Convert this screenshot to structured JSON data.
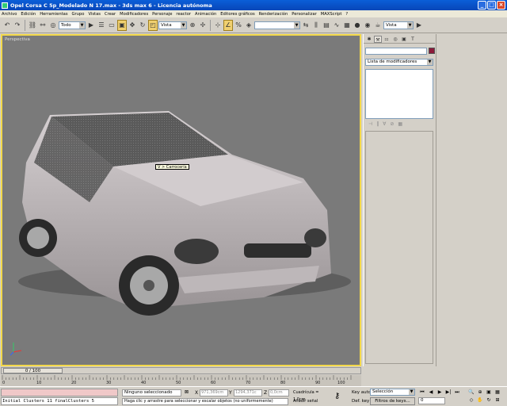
{
  "window": {
    "title": "Opel Corsa C 5p_Modelado N 17.max - 3ds max 6 - Licencia autónoma",
    "controls": [
      "_",
      "□",
      "×"
    ]
  },
  "menu": [
    "Archivo",
    "Edición",
    "Herramientas",
    "Grupo",
    "Vistas",
    "Crear",
    "Modificadores",
    "Personaje",
    "reactor",
    "Animación",
    "Editores gráficos",
    "Renderización",
    "Personalizar",
    "MAXScript",
    "?"
  ],
  "toolbar": {
    "selection_filter": "Todo",
    "ref_coord": "Vista",
    "named_sel": "",
    "render_view": "Vista"
  },
  "viewport": {
    "label": "Perspectiva",
    "tooltip": "V > Carrocería"
  },
  "command_panel": {
    "name_value": "",
    "object_color": "#8b1a3a",
    "modifier_list": "Lista de modificadores"
  },
  "time_slider": {
    "position": "0 / 100"
  },
  "trackbar": {
    "ticks": [
      "0",
      "10",
      "20",
      "30",
      "40",
      "50",
      "60",
      "70",
      "80",
      "90",
      "100"
    ]
  },
  "status": {
    "listener_output": "Initial Clusters 11 finalClusters 5",
    "selection": "Ninguno seleccionado",
    "x_label": "X",
    "x_value": "971,369cm",
    "y_label": "Y",
    "y_value": "1294,371c",
    "z_label": "Z",
    "z_value": "0,0cm",
    "grid": "Cuadrícula = 1,0cm",
    "prompt": "Haga clic y arrastre para seleccionar y escalar objetos (no uniformemente)",
    "add_tag": "Añadir señal tiempo",
    "key_auto_label": "Key auto",
    "key_set_label": "Def. key",
    "key_mode": "Selección",
    "key_filters": "Filtros de keys...",
    "frame": "0"
  }
}
